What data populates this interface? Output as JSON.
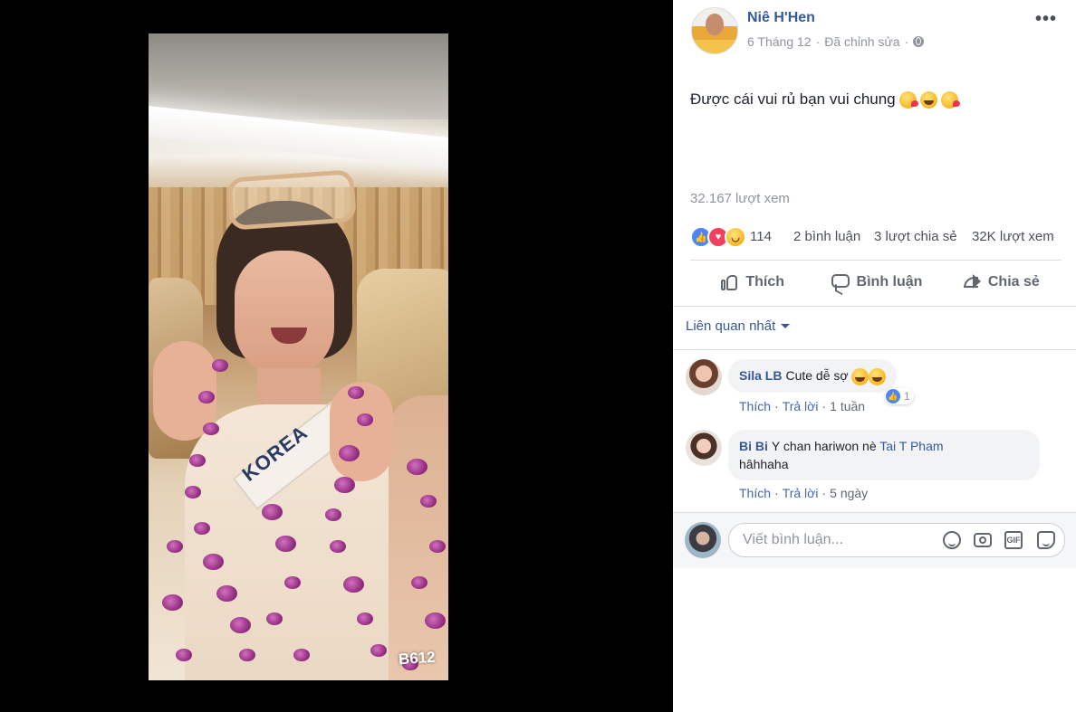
{
  "video": {
    "watermark": "B612",
    "sash_text": "KOREA"
  },
  "post": {
    "author": "Niê H'Hen",
    "date": "6 Tháng 12",
    "edited": "Đã chỉnh sửa",
    "privacy_icon": "globe-icon",
    "more_label": "•••",
    "text": "Được cái vui rủ bạn vui chung",
    "text_emojis": [
      "kiss-emoji",
      "laugh-emoji",
      "kiss-emoji"
    ],
    "views_total": "32.167 lượt xem"
  },
  "stats": {
    "reaction_icons": [
      "like-icon",
      "love-icon",
      "haha-icon"
    ],
    "reaction_count": "114",
    "comments": "2 bình luận",
    "shares": "3 lượt chia sẻ",
    "views": "32K lượt xem"
  },
  "actions": {
    "like": "Thích",
    "comment": "Bình luận",
    "share": "Chia sẻ"
  },
  "comments_sort": "Liên quan nhất",
  "comments": [
    {
      "name": "Sila LB",
      "text": "Cute dễ sợ",
      "emojis": [
        "laugh-emoji",
        "laugh-emoji"
      ],
      "like": "Thích",
      "reply": "Trả lời",
      "time": "1 tuần",
      "reaction_count": "1"
    },
    {
      "name": "Bi Bi",
      "text": "Y chan hariwon nè",
      "mention": "Tai T Pham",
      "text2": "hâhhaha",
      "like": "Thích",
      "reply": "Trả lời",
      "time": "5 ngày"
    }
  ],
  "composer": {
    "placeholder": "Viết bình luận...",
    "tools": [
      "emoji-icon",
      "camera-icon",
      "gif-icon",
      "sticker-icon"
    ],
    "gif_label": "GIF"
  },
  "colors": {
    "link": "#365899",
    "meta_gray": "#90949c",
    "action_gray": "#606770",
    "like_blue": "#4b86f7",
    "love_red": "#f0405e"
  }
}
